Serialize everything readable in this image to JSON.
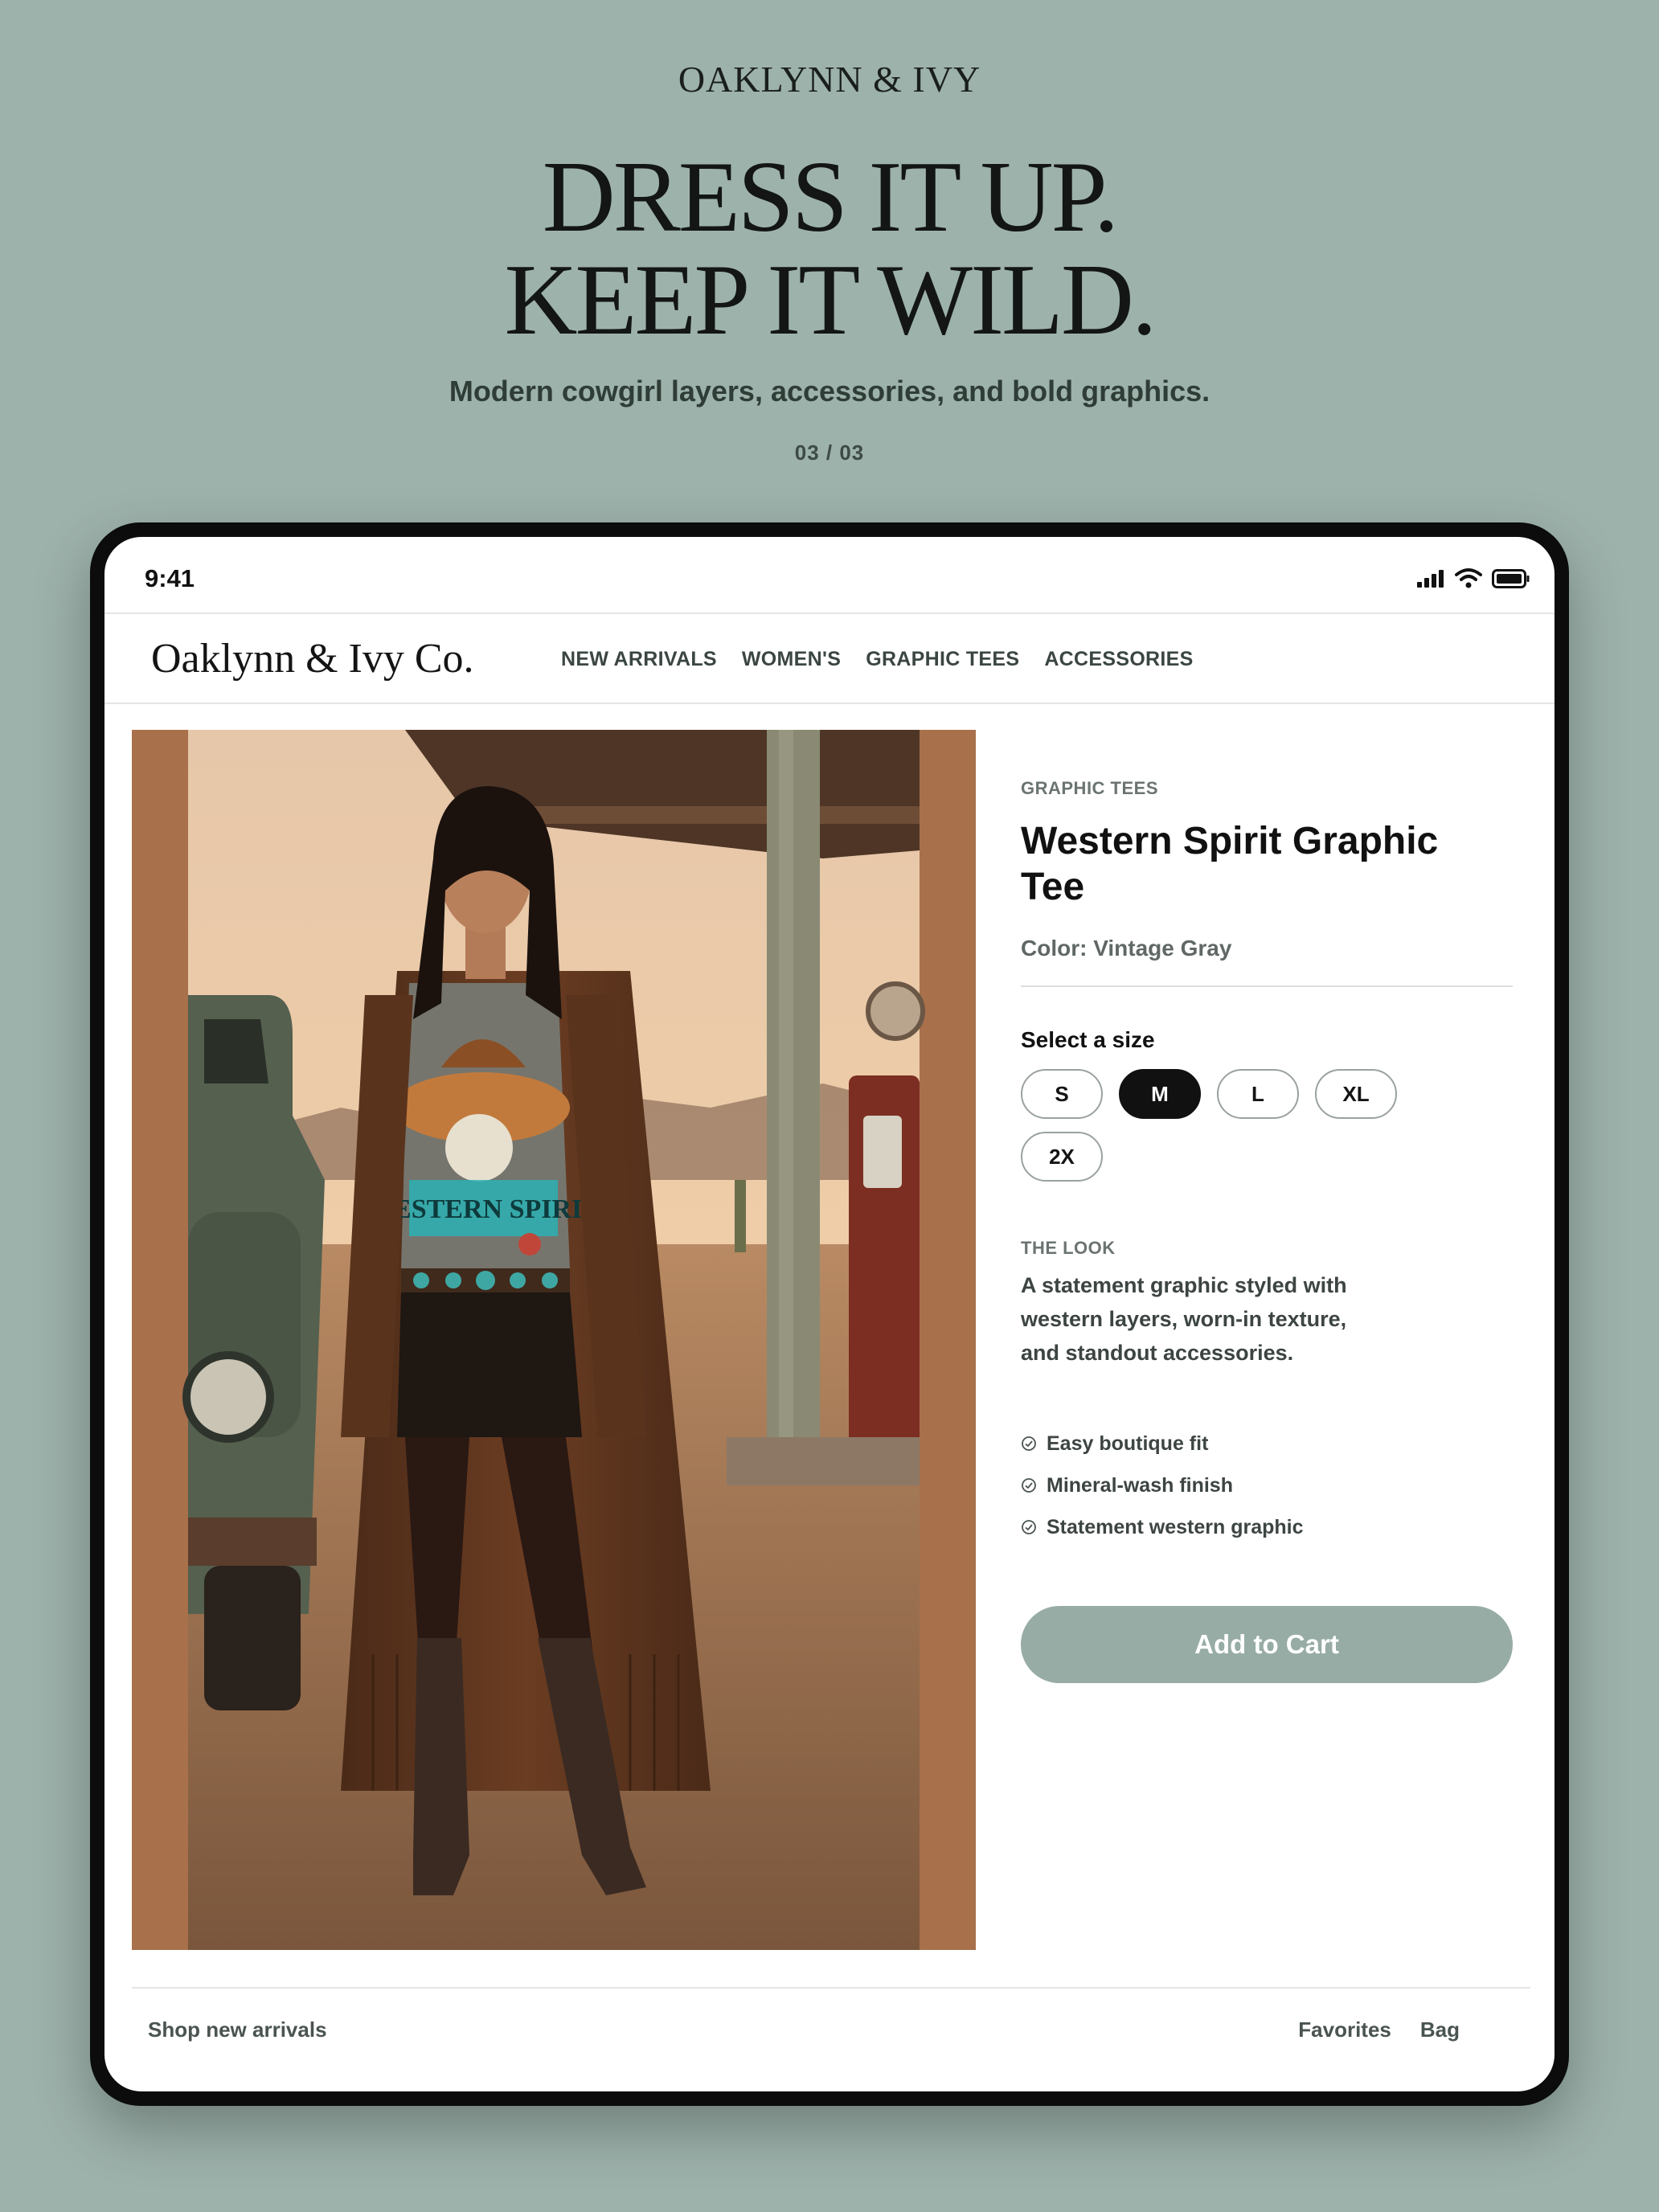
{
  "hero": {
    "brand": "OAKLYNN & IVY",
    "headline_line1": "DRESS IT UP.",
    "headline_line2": "KEEP IT WILD.",
    "subhead": "Modern cowgirl layers, accessories, and bold graphics.",
    "counter": "03 / 03"
  },
  "status_bar": {
    "time": "9:41",
    "icons": [
      "signal-icon",
      "wifi-icon",
      "battery-icon"
    ]
  },
  "nav": {
    "logo": "Oaklynn & Ivy Co.",
    "links": [
      "NEW ARRIVALS",
      "WOMEN'S",
      "GRAPHIC TEES",
      "ACCESSORIES"
    ]
  },
  "product": {
    "category": "GRAPHIC TEES",
    "title": "Western Spirit Graphic Tee",
    "color_label": "Color: Vintage Gray",
    "size_label": "Select a size",
    "sizes": [
      "S",
      "M",
      "L",
      "XL",
      "2X"
    ],
    "selected_size": "M",
    "look_label": "THE LOOK",
    "look_text": "A statement graphic styled with western layers, worn-in texture, and standout accessories.",
    "features": [
      "Easy boutique fit",
      "Mineral-wash finish",
      "Statement western graphic"
    ],
    "add_to_cart": "Add to Cart",
    "image_graphic_text": "WESTERN SPIRIT"
  },
  "bottom_bar": {
    "left_link": "Shop new arrivals",
    "right_links": [
      "Favorites",
      "Bag"
    ]
  },
  "colors": {
    "background": "#9db2ab",
    "accent_button": "#97aca4",
    "image_frame": "#a8704b",
    "selected_size": "#111111"
  }
}
